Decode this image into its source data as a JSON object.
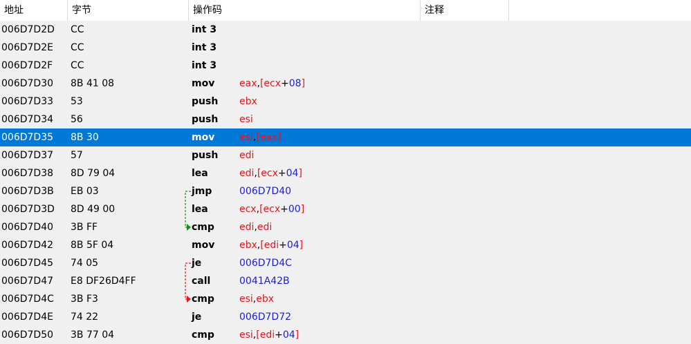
{
  "columns": [
    "地址",
    "字节",
    "操作码",
    "注释"
  ],
  "selected_row": 6,
  "colors": {
    "register": "#e8141e",
    "number": "#1a1ae6",
    "selection": "#0078d7",
    "jump_arrow_taken": "#1a8c1a",
    "jump_arrow_conditional": "#e8141e"
  },
  "rows": [
    {
      "addr": "006D7D2D",
      "bytes": "CC",
      "mnem": "int 3",
      "ops": []
    },
    {
      "addr": "006D7D2E",
      "bytes": "CC",
      "mnem": "int 3",
      "ops": []
    },
    {
      "addr": "006D7D2F",
      "bytes": "CC",
      "mnem": "int 3",
      "ops": []
    },
    {
      "addr": "006D7D30",
      "bytes": "8B 41 08",
      "mnem": "mov",
      "ops": [
        [
          "r",
          "eax"
        ],
        [
          "p",
          ","
        ],
        [
          "r",
          "[ecx"
        ],
        [
          "p",
          "+"
        ],
        [
          "n",
          "08"
        ],
        [
          "r",
          "]"
        ]
      ]
    },
    {
      "addr": "006D7D33",
      "bytes": "53",
      "mnem": "push",
      "ops": [
        [
          "r",
          "ebx"
        ]
      ]
    },
    {
      "addr": "006D7D34",
      "bytes": "56",
      "mnem": "push",
      "ops": [
        [
          "r",
          "esi"
        ]
      ]
    },
    {
      "addr": "006D7D35",
      "bytes": "8B 30",
      "mnem": "mov",
      "ops": [
        [
          "r",
          "esi"
        ],
        [
          "p",
          ","
        ],
        [
          "r",
          "[eax]"
        ]
      ]
    },
    {
      "addr": "006D7D37",
      "bytes": "57",
      "mnem": "push",
      "ops": [
        [
          "r",
          "edi"
        ]
      ]
    },
    {
      "addr": "006D7D38",
      "bytes": "8D 79 04",
      "mnem": "lea",
      "ops": [
        [
          "r",
          "edi"
        ],
        [
          "p",
          ","
        ],
        [
          "r",
          "[ecx"
        ],
        [
          "p",
          "+"
        ],
        [
          "n",
          "04"
        ],
        [
          "r",
          "]"
        ]
      ]
    },
    {
      "addr": "006D7D3B",
      "bytes": "EB 03",
      "mnem": "jmp",
      "ops": [
        [
          "n",
          "006D7D40"
        ]
      ]
    },
    {
      "addr": "006D7D3D",
      "bytes": "8D 49 00",
      "mnem": "lea",
      "ops": [
        [
          "r",
          "ecx"
        ],
        [
          "p",
          ","
        ],
        [
          "r",
          "[ecx"
        ],
        [
          "p",
          "+"
        ],
        [
          "n",
          "00"
        ],
        [
          "r",
          "]"
        ]
      ]
    },
    {
      "addr": "006D7D40",
      "bytes": "3B FF",
      "mnem": "cmp",
      "ops": [
        [
          "r",
          "edi"
        ],
        [
          "p",
          ","
        ],
        [
          "r",
          "edi"
        ]
      ]
    },
    {
      "addr": "006D7D42",
      "bytes": "8B 5F 04",
      "mnem": "mov",
      "ops": [
        [
          "r",
          "ebx"
        ],
        [
          "p",
          ","
        ],
        [
          "r",
          "[edi"
        ],
        [
          "p",
          "+"
        ],
        [
          "n",
          "04"
        ],
        [
          "r",
          "]"
        ]
      ]
    },
    {
      "addr": "006D7D45",
      "bytes": "74 05",
      "mnem": "je",
      "ops": [
        [
          "n",
          "006D7D4C"
        ]
      ]
    },
    {
      "addr": "006D7D47",
      "bytes": "E8 DF26D4FF",
      "mnem": "call",
      "ops": [
        [
          "n",
          "0041A42B"
        ]
      ]
    },
    {
      "addr": "006D7D4C",
      "bytes": "3B F3",
      "mnem": "cmp",
      "ops": [
        [
          "r",
          "esi"
        ],
        [
          "p",
          ","
        ],
        [
          "r",
          "ebx"
        ]
      ]
    },
    {
      "addr": "006D7D4E",
      "bytes": "74 22",
      "mnem": "je",
      "ops": [
        [
          "n",
          "006D7D72"
        ]
      ]
    },
    {
      "addr": "006D7D50",
      "bytes": "3B 77 04",
      "mnem": "cmp",
      "ops": [
        [
          "r",
          "esi"
        ],
        [
          "p",
          ","
        ],
        [
          "r",
          "[edi"
        ],
        [
          "p",
          "+"
        ],
        [
          "n",
          "04"
        ],
        [
          "r",
          "]"
        ]
      ]
    }
  ],
  "jumps": [
    {
      "from": 9,
      "to": 11,
      "style": "taken"
    },
    {
      "from": 13,
      "to": 15,
      "style": "conditional"
    }
  ]
}
